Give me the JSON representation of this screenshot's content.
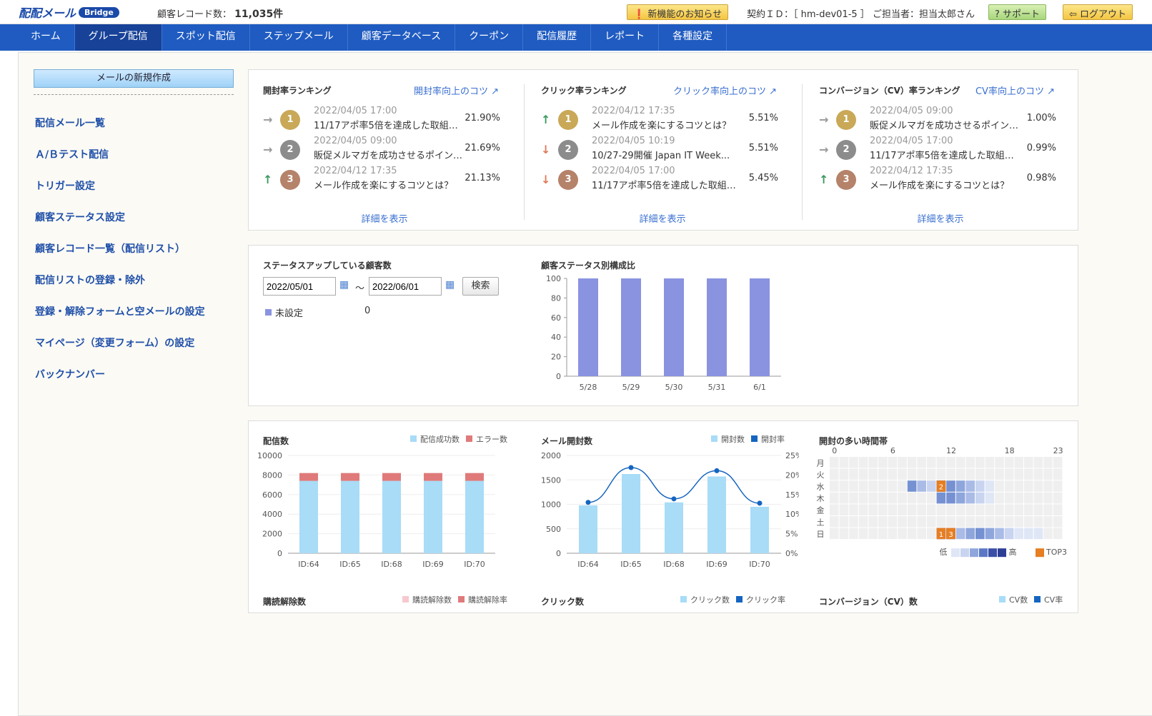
{
  "header": {
    "logo_text": "配配メール",
    "logo_badge": "Bridge",
    "record_label": "顧客レコード数：",
    "record_value": "11,035件",
    "news_btn": "新機能のお知らせ",
    "contract": "契約ＩＤ：［ hm-dev01-5 ］ ご担当者：担当太郎さん",
    "support_btn": "サポート",
    "logout_btn": "ログアウト"
  },
  "nav": [
    "ホーム",
    "グループ配信",
    "スポット配信",
    "ステップメール",
    "顧客データベース",
    "クーポン",
    "配信履歴",
    "レポート",
    "各種設定"
  ],
  "sidebar": {
    "new_btn": "メールの新規作成",
    "items": [
      "配信メール一覧",
      "Ａ/Ｂテスト配信",
      "トリガー設定",
      "顧客ステータス設定",
      "顧客レコード一覧（配信リスト）",
      "配信リストの登録・除外",
      "登録・解除フォームと空メールの設定",
      "マイページ（変更フォーム）の設定",
      "バックナンバー"
    ]
  },
  "rankings": [
    {
      "title": "開封率ランキング",
      "tip": "開封率向上のコツ",
      "more": "詳細を表示",
      "rows": [
        {
          "trend": "flat",
          "rank": "1",
          "date": "2022/04/05 17:00",
          "title": "11/17アポ率5倍を達成した取組み...",
          "value": "21.90%"
        },
        {
          "trend": "flat",
          "rank": "2",
          "date": "2022/04/05 09:00",
          "title": "販促メルマガを成功させるポイント...",
          "value": "21.69%"
        },
        {
          "trend": "up",
          "rank": "3",
          "date": "2022/04/12 17:35",
          "title": "メール作成を楽にするコツとは？",
          "value": "21.13%"
        }
      ]
    },
    {
      "title": "クリック率ランキング",
      "tip": "クリック率向上のコツ",
      "more": "詳細を表示",
      "rows": [
        {
          "trend": "up",
          "rank": "1",
          "date": "2022/04/12 17:35",
          "title": "メール作成を楽にするコツとは？",
          "value": "5.51%"
        },
        {
          "trend": "down",
          "rank": "2",
          "date": "2022/04/05 10:19",
          "title": "10/27-29開催 Japan IT Week...",
          "value": "5.51%"
        },
        {
          "trend": "down",
          "rank": "3",
          "date": "2022/04/05 17:00",
          "title": "11/17アポ率5倍を達成した取組み...",
          "value": "5.45%"
        }
      ]
    },
    {
      "title": "コンバージョン（CV）率ランキング",
      "tip": "CV率向上のコツ",
      "more": "詳細を表示",
      "rows": [
        {
          "trend": "flat",
          "rank": "1",
          "date": "2022/04/05 09:00",
          "title": "販促メルマガを成功させるポイント...",
          "value": "1.00%"
        },
        {
          "trend": "flat",
          "rank": "2",
          "date": "2022/04/05 17:00",
          "title": "11/17アポ率5倍を達成した取組み...",
          "value": "0.99%"
        },
        {
          "trend": "up",
          "rank": "3",
          "date": "2022/04/12 17:35",
          "title": "メール作成を楽にするコツとは？",
          "value": "0.98%"
        }
      ]
    }
  ],
  "status": {
    "title": "ステータスアップしている顧客数",
    "date_from": "2022/05/01",
    "date_to": "2022/06/01",
    "tilde": "～",
    "search_btn": "検索",
    "legend_label": "未設定",
    "legend_value": "0",
    "chart_title": "顧客ステータス別構成比"
  },
  "colors": {
    "accent": "#1f5bc1",
    "bar_status": "#8a93e0",
    "bar_success": "#a8dcf7",
    "bar_error": "#e07a7a",
    "line": "#1565c0",
    "top3": "#e67e22"
  },
  "chart_data": [
    {
      "type": "bar",
      "title": "顧客ステータス別構成比",
      "categories": [
        "5/28",
        "5/29",
        "5/30",
        "5/31",
        "6/1"
      ],
      "values": [
        100,
        100,
        100,
        100,
        100
      ],
      "ylim": [
        0,
        100
      ],
      "yticks": [
        0,
        20,
        40,
        60,
        80,
        100
      ]
    },
    {
      "type": "bar",
      "title": "配信数",
      "stacked": true,
      "categories": [
        "ID:64",
        "ID:65",
        "ID:68",
        "ID:69",
        "ID:70"
      ],
      "series": [
        {
          "name": "配信成功数",
          "values": [
            7400,
            7400,
            7400,
            7400,
            7400
          ]
        },
        {
          "name": "エラー数",
          "values": [
            800,
            800,
            800,
            800,
            800
          ]
        }
      ],
      "ylim": [
        0,
        10000
      ],
      "yticks": [
        0,
        2000,
        4000,
        6000,
        8000,
        10000
      ]
    },
    {
      "type": "bar",
      "title": "メール開封数",
      "categories": [
        "ID:64",
        "ID:65",
        "ID:68",
        "ID:69",
        "ID:70"
      ],
      "series": [
        {
          "name": "開封数",
          "type": "bar",
          "values": [
            980,
            1620,
            1040,
            1570,
            950
          ]
        },
        {
          "name": "開封率",
          "type": "line",
          "values": [
            13.0,
            21.9,
            13.9,
            21.1,
            12.8
          ]
        }
      ],
      "ylim": [
        0,
        2000
      ],
      "yticks": [
        0,
        500,
        1000,
        1500,
        2000
      ],
      "y2lim": [
        0,
        25
      ],
      "y2ticks": [
        "0%",
        "5%",
        "10%",
        "15%",
        "20%",
        "25%"
      ]
    },
    {
      "type": "heatmap",
      "title": "開封の多い時間帯",
      "x_ticks": [
        "0",
        "6",
        "12",
        "18",
        "23"
      ],
      "rows": [
        "月",
        "火",
        "水",
        "木",
        "金",
        "土",
        "日"
      ],
      "levels": [
        [
          0,
          0,
          0,
          0,
          0,
          0,
          0,
          0,
          0,
          0,
          0,
          0,
          0,
          0,
          0,
          0,
          0,
          0,
          0,
          0,
          0,
          0,
          0,
          0
        ],
        [
          0,
          0,
          0,
          0,
          0,
          0,
          0,
          0,
          0,
          0,
          0,
          0,
          0,
          0,
          0,
          0,
          0,
          0,
          0,
          0,
          0,
          0,
          0,
          0
        ],
        [
          0,
          0,
          0,
          0,
          0,
          0,
          0,
          0,
          5,
          3,
          2,
          9,
          5,
          4,
          3,
          2,
          1,
          0,
          0,
          0,
          0,
          0,
          0,
          0
        ],
        [
          0,
          0,
          0,
          0,
          0,
          0,
          0,
          0,
          0,
          0,
          0,
          5,
          5,
          4,
          3,
          2,
          1,
          0,
          0,
          0,
          0,
          0,
          0,
          0
        ],
        [
          0,
          0,
          0,
          0,
          0,
          0,
          0,
          0,
          0,
          0,
          0,
          0,
          0,
          0,
          0,
          0,
          0,
          0,
          0,
          0,
          0,
          0,
          0,
          0
        ],
        [
          0,
          0,
          0,
          0,
          0,
          0,
          0,
          0,
          0,
          0,
          0,
          0,
          0,
          0,
          0,
          0,
          0,
          0,
          0,
          0,
          0,
          0,
          0,
          0
        ],
        [
          0,
          0,
          0,
          0,
          0,
          0,
          0,
          0,
          0,
          0,
          0,
          9,
          9,
          3,
          4,
          5,
          4,
          3,
          2,
          1,
          1,
          1,
          0,
          0
        ]
      ],
      "top3": [
        {
          "row": 2,
          "col": 11,
          "label": "2"
        },
        {
          "row": 6,
          "col": 11,
          "label": "1"
        },
        {
          "row": 6,
          "col": 12,
          "label": "3"
        }
      ],
      "legend": {
        "low": "低",
        "high": "高",
        "top3": "TOP3"
      }
    }
  ],
  "bottom": {
    "deliv_title": "配信数",
    "deliv_leg1": "配信成功数",
    "deliv_leg2": "エラー数",
    "open_title": "メール開封数",
    "open_leg1": "開封数",
    "open_leg2": "開封率",
    "heat_title": "開封の多い時間帯",
    "unsub_title": "購読解除数",
    "unsub_leg1": "購読解除数",
    "unsub_leg2": "購読解除率",
    "click_title": "クリック数",
    "click_leg1": "クリック数",
    "click_leg2": "クリック率",
    "cv_title": "コンバージョン（CV）数",
    "cv_leg1": "CV数",
    "cv_leg2": "CV率"
  }
}
